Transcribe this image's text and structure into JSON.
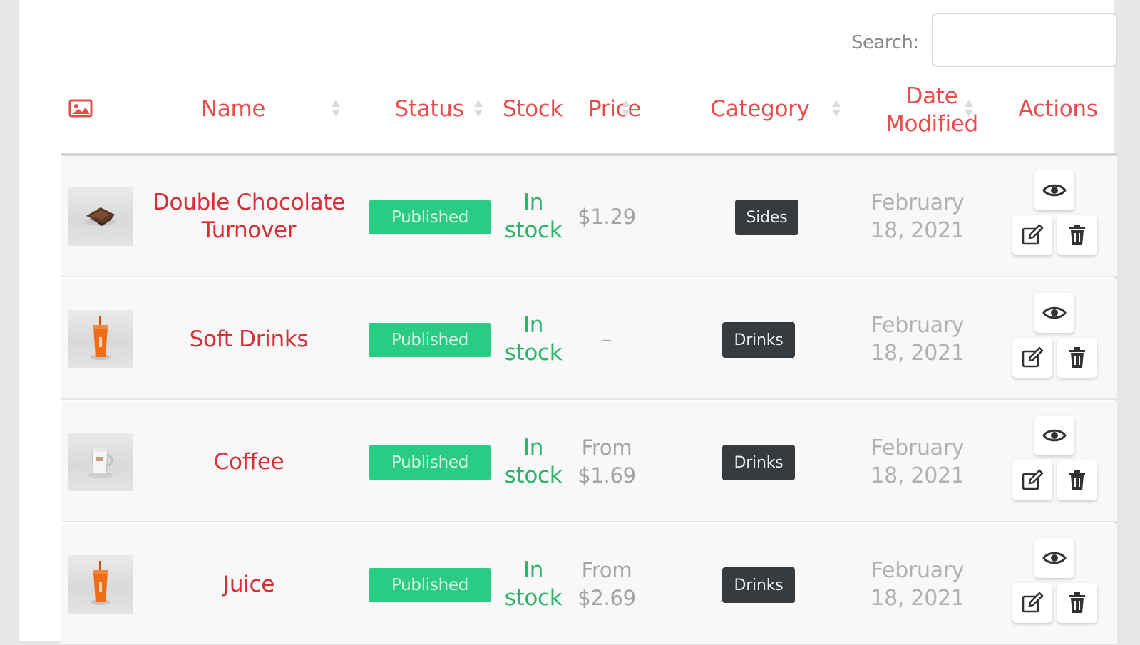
{
  "search": {
    "label": "Search:",
    "value": "",
    "placeholder": ""
  },
  "table": {
    "columns": {
      "image_icon": "image-icon",
      "name": "Name",
      "status": "Status",
      "stock": "Stock",
      "price": "Price",
      "category": "Category",
      "date_modified": "Date Modified",
      "actions": "Actions"
    },
    "rows": [
      {
        "thumbnail": "turnover-thumbnail",
        "name": "Double Chocolate Turnover",
        "status": "Published",
        "stock": "In stock",
        "price": "$1.29",
        "category": "Sides",
        "date": "February 18, 2021"
      },
      {
        "thumbnail": "drink-cup-thumbnail",
        "name": "Soft Drinks",
        "status": "Published",
        "stock": "In stock",
        "price": "–",
        "category": "Drinks",
        "date": "February 18, 2021"
      },
      {
        "thumbnail": "coffee-mug-thumbnail",
        "name": "Coffee",
        "status": "Published",
        "stock": "In stock",
        "price": "From\n$1.69",
        "category": "Drinks",
        "date": "February 18, 2021"
      },
      {
        "thumbnail": "drink-cup-thumbnail",
        "name": "Juice",
        "status": "Published",
        "stock": "In stock",
        "price": "From\n$2.69",
        "category": "Drinks",
        "date": "February 18, 2021"
      }
    ],
    "action_icons": [
      "eye-icon",
      "edit-icon",
      "trash-icon"
    ]
  },
  "colors": {
    "header_text": "#ea4b4b",
    "product_name": "#d62f36",
    "status_badge": "#2acb83",
    "stock_text": "#2db36b",
    "category_badge": "#363b40",
    "muted_text": "#a3a3a3"
  }
}
